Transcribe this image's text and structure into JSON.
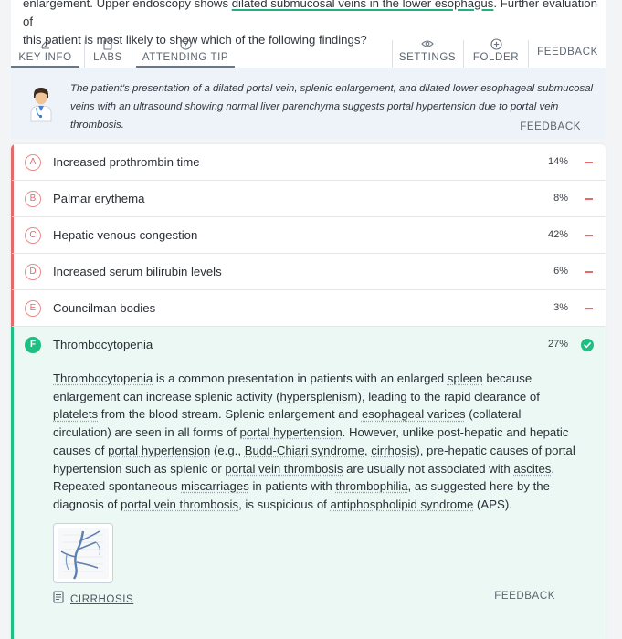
{
  "question": {
    "pre": "enlargement. Upper endoscopy shows ",
    "highlight": "dilated submucosal veins in the lower esophagus",
    "post": ". Further evaluation of",
    "line2": "this patient is most likely to show which of the following findings?"
  },
  "tabs": {
    "key_info": "KEY INFO",
    "labs": "LABS",
    "attending_tip": "ATTENDING TIP",
    "settings": "SETTINGS",
    "folder": "FOLDER",
    "feedback": "FEEDBACK"
  },
  "tip": {
    "text": "The patient's presentation of a dilated portal vein, splenic enlargement, and dilated lower esophageal submucosal veins with an ultrasound showing normal liver parenchyma suggests portal hypertension due to portal vein thrombosis.",
    "feedback": "FEEDBACK"
  },
  "answers": [
    {
      "letter": "A",
      "label": "Increased prothrombin time",
      "percent": "14%"
    },
    {
      "letter": "B",
      "label": "Palmar erythema",
      "percent": "8%"
    },
    {
      "letter": "C",
      "label": "Hepatic venous congestion",
      "percent": "42%"
    },
    {
      "letter": "D",
      "label": "Increased serum bilirubin levels",
      "percent": "6%"
    },
    {
      "letter": "E",
      "label": "Councilman bodies",
      "percent": "3%"
    },
    {
      "letter": "F",
      "label": "Thrombocytopenia",
      "percent": "27%"
    }
  ],
  "explanation": {
    "s1": "Thrombocytopenia",
    "s2": " is a common presentation in patients with an enlarged ",
    "s3": "spleen",
    "s4": " because enlargement can increase splenic activity (",
    "s5": "hypersplenism",
    "s6": "), leading to the rapid clearance of ",
    "s7": "platelets",
    "s8": " from the blood stream. Splenic enlargement and ",
    "s9": "esophageal varices",
    "s10": " (collateral circulation) are seen in all forms of ",
    "s11": "portal hypertension",
    "s12": ". However, unlike post-hepatic and hepatic causes of ",
    "s13": "portal hypertension",
    "s14": " (e.g., ",
    "s15": "Budd-Chiari syndrome",
    "s16": ", ",
    "s17": "cirrhosis",
    "s18": "), pre-hepatic causes of portal hypertension such as splenic or ",
    "s19": "portal vein thrombosis",
    "s20": " are usually not associated with ",
    "s21": "ascites",
    "s22": ". Repeated spontaneous ",
    "s23": "miscarriages",
    "s24": " in patients with ",
    "s25": "thrombophilia",
    "s26": ", as suggested here by the diagnosis of ",
    "s27": "portal vein thrombosis",
    "s28": ", is suspicious of ",
    "s29": "antiphospholipid syndrome",
    "s30": " (APS).",
    "topic": "CIRRHOSIS",
    "feedback": "FEEDBACK"
  },
  "colors": {
    "correct": "#1fbf84",
    "incorrect": "#e26b6b",
    "tip_bg": "#eef3f9"
  },
  "icons": [
    "pencil-icon",
    "clipboard-icon",
    "help-circle-icon",
    "eye-icon",
    "plus-circle-icon",
    "doctor-avatar-icon",
    "check-circle-icon",
    "article-icon"
  ]
}
